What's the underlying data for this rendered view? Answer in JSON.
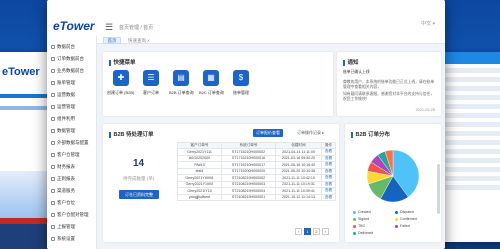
{
  "brand": {
    "logo": "eTower",
    "color_primary": "#1e63c7"
  },
  "ghost_left": {
    "logo": "eTower"
  },
  "header": {
    "breadcrumb": "首页管理 / 首页",
    "tabs": [
      {
        "label": "首页"
      },
      {
        "label": "快速查询 ×"
      }
    ],
    "right_text": "中文 ▾"
  },
  "sidebar": {
    "items": [
      {
        "label": "数据前台"
      },
      {
        "label": "订单数据前台"
      },
      {
        "label": "业务数据前台"
      },
      {
        "label": "账单管理"
      },
      {
        "label": "运营数据"
      },
      {
        "label": "运营管理"
      },
      {
        "label": "组件利用"
      },
      {
        "label": "数据管理"
      },
      {
        "label": "外部数据与配置"
      },
      {
        "label": "客户仓管理"
      },
      {
        "label": "财务报表"
      },
      {
        "label": "正则报表"
      },
      {
        "label": "渠道服务"
      },
      {
        "label": "客户仓位"
      },
      {
        "label": "客户仓配对管理"
      },
      {
        "label": "上报管理"
      },
      {
        "label": "系统设置"
      }
    ]
  },
  "quick_actions": {
    "title": "快捷菜单",
    "items": [
      {
        "label": "创建订单 (B2B)",
        "icon": "doc-add-icon"
      },
      {
        "label": "客户订单",
        "icon": "list-icon"
      },
      {
        "label": "B2B 订单查询",
        "icon": "doc-icon"
      },
      {
        "label": "B2C 订单查询",
        "icon": "form-icon"
      },
      {
        "label": "账单管理",
        "icon": "bill-icon"
      }
    ]
  },
  "notice": {
    "title": "通知",
    "subtitle": "账单已确认上线",
    "lines": [
      "尊敬的用户，本系统的账单功能已正式上线，请在账单管理中查看相关内容，",
      "如有疑问请联系客服，感谢您对本平台的支持与信任，祝您工作愉快！"
    ],
    "date": "2021-05-28"
  },
  "orders": {
    "title": "B2B 待处理订单",
    "count": "14",
    "count_label": "待完成数量 (单)",
    "update_button": "订仓已资料完整",
    "button_export": "订单报价查看",
    "link_more": "订单操作记录 ▸",
    "columns": [
      "客户订单号",
      "系统订单号",
      "创建时间",
      "操作"
    ],
    "rows": [
      [
        "Gerry2021Y111",
        "ST1715210H000002",
        "2021-04-14 11:11:00",
        "查看"
      ],
      [
        "A0G0202000",
        "ST1715210H000016",
        "2021-03-16 09:50:20",
        "查看"
      ],
      [
        "PA#13",
        "ST1715210H000017",
        "2021-05-18 10:16:40",
        "查看"
      ],
      [
        "test4",
        "ST1715200H000020",
        "2021-05-20 10:10:36",
        "查看"
      ],
      [
        "Gerry2021YIIIIIII1",
        "ST2108219H000002",
        "2021-11-11 10:42:10",
        "查看"
      ],
      [
        "Gerry2021Y1IIIVI",
        "ST2108219H000003",
        "2021-11-11 10:19:31",
        "查看"
      ],
      [
        "Gerry2021IY1II",
        "ST2108219H000004",
        "2021-11-11 10:39:41",
        "查看"
      ],
      [
        "yangjjlsdfwwf",
        "ST2108219H000001",
        "2021-10-12 11:14:13",
        "查看"
      ]
    ],
    "pagination": {
      "current": "1",
      "next": "2"
    }
  },
  "status_pie": {
    "title": "B2B 订单分布",
    "legend": [
      {
        "label": "Created",
        "color": "#4fc3f7"
      },
      {
        "label": "Dispatch",
        "color": "#1565c0"
      },
      {
        "label": "Signed",
        "color": "#66bb6a"
      },
      {
        "label": "Confirmed",
        "color": "#fdd835"
      },
      {
        "label": "TBC",
        "color": "#ef5350"
      },
      {
        "label": "Failed",
        "color": "#ab47bc"
      },
      {
        "label": "Delivered",
        "color": "#26a69a"
      },
      {
        "label": "",
        "color": "#ff7043"
      }
    ]
  }
}
